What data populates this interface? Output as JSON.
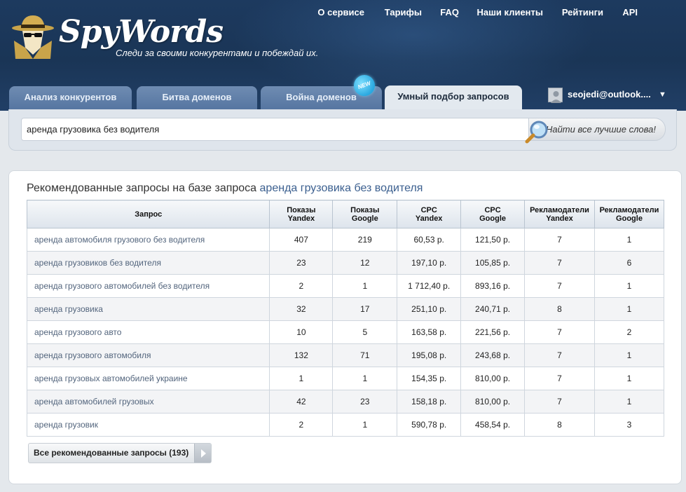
{
  "brand": {
    "name": "SpyWords",
    "tagline": "Следи за своими конкурентами и побеждай их."
  },
  "topnav": [
    "О сервисе",
    "Тарифы",
    "FAQ",
    "Наши клиенты",
    "Рейтинги",
    "API"
  ],
  "tabs": [
    {
      "label": "Анализ конкурентов",
      "active": false
    },
    {
      "label": "Битва доменов",
      "active": false
    },
    {
      "label": "Война доменов",
      "active": false,
      "badge": "NEW"
    },
    {
      "label": "Умный подбор запросов",
      "active": true
    }
  ],
  "user": {
    "email": "seojedi@outlook...."
  },
  "search": {
    "value": "аренда грузовика без водителя",
    "button_label": "Найти все лучшие слова!"
  },
  "results": {
    "title_prefix": "Рекомендованные запросы на базе запроса",
    "title_query": "аренда грузовика без водителя",
    "columns": [
      {
        "line1": "Запрос",
        "line2": ""
      },
      {
        "line1": "Показы",
        "line2": "Yandex"
      },
      {
        "line1": "Показы",
        "line2": "Google"
      },
      {
        "line1": "CPC",
        "line2": "Yandex"
      },
      {
        "line1": "CPC",
        "line2": "Google"
      },
      {
        "line1": "Рекламодатели",
        "line2": "Yandex"
      },
      {
        "line1": "Рекламодатели",
        "line2": "Google"
      }
    ],
    "rows": [
      [
        "аренда автомобиля грузового без водителя",
        "407",
        "219",
        "60,53 р.",
        "121,50 р.",
        "7",
        "1"
      ],
      [
        "аренда грузовиков без водителя",
        "23",
        "12",
        "197,10 р.",
        "105,85 р.",
        "7",
        "6"
      ],
      [
        "аренда грузового автомобилей без водителя",
        "2",
        "1",
        "1 712,40 р.",
        "893,16 р.",
        "7",
        "1"
      ],
      [
        "аренда грузовика",
        "32",
        "17",
        "251,10 р.",
        "240,71 р.",
        "8",
        "1"
      ],
      [
        "аренда грузового авто",
        "10",
        "5",
        "163,58 р.",
        "221,56 р.",
        "7",
        "2"
      ],
      [
        "аренда грузового автомобиля",
        "132",
        "71",
        "195,08 р.",
        "243,68 р.",
        "7",
        "1"
      ],
      [
        "аренда грузовых автомобилей украине",
        "1",
        "1",
        "154,35 р.",
        "810,00 р.",
        "7",
        "1"
      ],
      [
        "аренда автомобилей грузовых",
        "42",
        "23",
        "158,18 р.",
        "810,00 р.",
        "7",
        "1"
      ],
      [
        "аренда грузовик",
        "2",
        "1",
        "590,78 р.",
        "458,54 р.",
        "8",
        "3"
      ]
    ],
    "all_button_label": "Все рекомендованные запросы (193)"
  },
  "colors": {
    "header_bg": "#1d3a5f",
    "tab_bg": "#5474a0",
    "tab_active_bg": "#e3e9ef",
    "link": "#3b5f8f"
  }
}
